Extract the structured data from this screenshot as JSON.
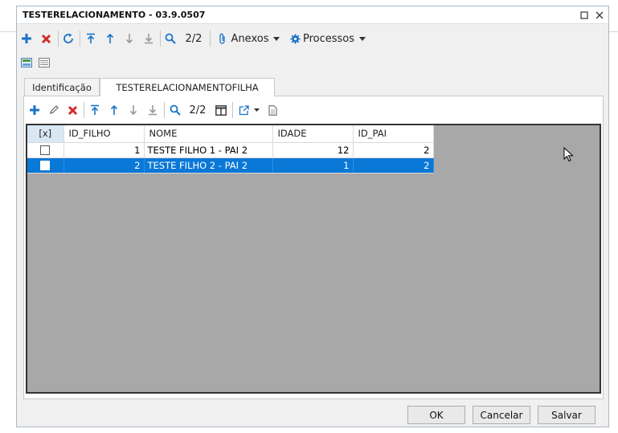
{
  "window": {
    "title": "TESTERELACIONAMENTO - 03.9.0507"
  },
  "toolbar": {
    "record_counter": "2/2",
    "anexos_label": "Anexos",
    "processos_label": "Processos"
  },
  "tabs": [
    {
      "label": "Identificação",
      "active": false
    },
    {
      "label": "TESTERELACIONAMENTOFILHA",
      "active": true
    }
  ],
  "subtoolbar": {
    "record_counter": "2/2"
  },
  "grid": {
    "columns": [
      "[x]",
      "ID_FILHO",
      "NOME",
      "IDADE",
      "ID_PAI"
    ],
    "rows": [
      {
        "checked": false,
        "id_filho": "1",
        "nome": "TESTE FILHO 1 - PAI 2",
        "idade": "12",
        "id_pai": "2",
        "selected": false
      },
      {
        "checked": false,
        "id_filho": "2",
        "nome": "TESTE FILHO 2 - PAI 2",
        "idade": "1",
        "id_pai": "2",
        "selected": true
      }
    ]
  },
  "footer": {
    "ok_label": "OK",
    "cancel_label": "Cancelar",
    "save_label": "Salvar"
  },
  "colors": {
    "accent": "#0a78d7",
    "add": "#1a73c8",
    "delete": "#d12b2b",
    "grid_bg": "#a8a8a8"
  }
}
